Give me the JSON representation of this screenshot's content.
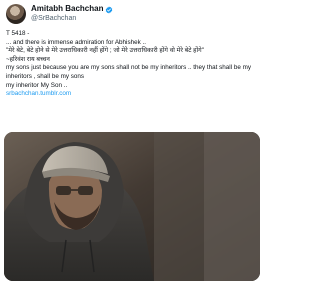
{
  "author": {
    "display_name": "Amitabh Bachchan",
    "handle": "@SrBachchan",
    "verified_color": "#1d9bf0"
  },
  "tweet": {
    "lines": [
      "T 5418 -",
      "... and there is immense admiration for Abhishek ..",
      "\"मेरे बेटे, बेटे होने से मेरे उत्तराधिकारी नहीं होंगे ; जो मेरे उत्तराधिकारी होंगे वो मेरे बेटे होंगे\"",
      "~हरिवंश राय बच्चन",
      "my sons just because you are my sons shall not be my inheritors .. they that shall be my inheritors , shall be my sons",
      "my inheritor My Son .."
    ],
    "link": "srbachchan.tumblr.com"
  },
  "media": {
    "icon": "photo-of-man-in-cap-and-hoodie"
  }
}
